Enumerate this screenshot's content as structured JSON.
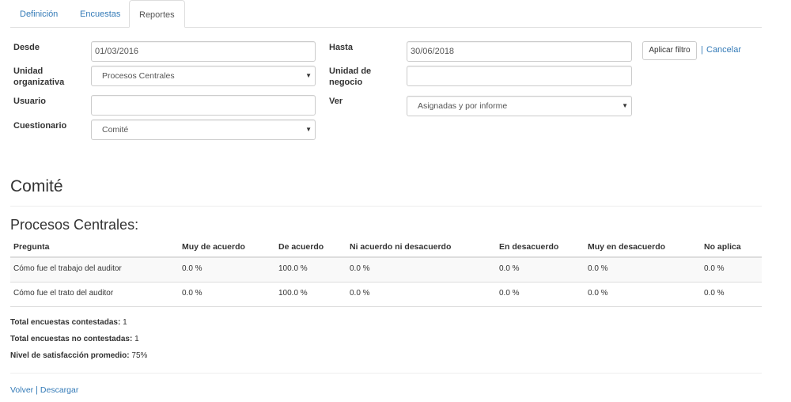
{
  "tabs": [
    {
      "label": "Definición"
    },
    {
      "label": "Encuestas"
    },
    {
      "label": "Reportes"
    }
  ],
  "filters": {
    "desde_label": "Desde",
    "desde_value": "01/03/2016",
    "hasta_label": "Hasta",
    "hasta_value": "30/06/2018",
    "apply_label": "Aplicar filtro",
    "separator": "|",
    "cancel_label": "Cancelar",
    "unidad_org_label_1": "Unidad",
    "unidad_org_label_2": "organizativa",
    "unidad_org_value": "Procesos Centrales",
    "unidad_neg_label_1": "Unidad de",
    "unidad_neg_label_2": "negocio",
    "unidad_neg_value": "",
    "usuario_label": "Usuario",
    "usuario_value": "",
    "ver_label": "Ver",
    "ver_value": "Asignadas y por informe",
    "cuestionario_label": "Cuestionario",
    "cuestionario_value": "Comité"
  },
  "report": {
    "title": "Comité",
    "group_title": "Procesos Centrales:",
    "columns": [
      "Pregunta",
      "Muy de acuerdo",
      "De acuerdo",
      "Ni acuerdo ni desacuerdo",
      "En desacuerdo",
      "Muy en desacuerdo",
      "No aplica"
    ],
    "rows": [
      [
        "Cómo fue el trabajo del auditor",
        "0.0 %",
        "100.0 %",
        "0.0 %",
        "0.0 %",
        "0.0 %",
        "0.0 %"
      ],
      [
        "Cómo fue el trato del auditor",
        "0.0 %",
        "100.0 %",
        "0.0 %",
        "0.0 %",
        "0.0 %",
        "0.0 %"
      ]
    ]
  },
  "summary": {
    "contestadas_label": "Total encuestas contestadas:",
    "contestadas_value": "1",
    "no_contestadas_label": "Total encuestas no contestadas:",
    "no_contestadas_value": "1",
    "satisfaccion_label": "Nivel de satisfacción promedio:",
    "satisfaccion_value": "75%"
  },
  "footer": {
    "back_label": "Volver",
    "separator": "|",
    "download_label": "Descargar"
  },
  "colors": {
    "link": "#337ab7",
    "border": "#dddddd",
    "stripe": "#f9f9f9"
  }
}
